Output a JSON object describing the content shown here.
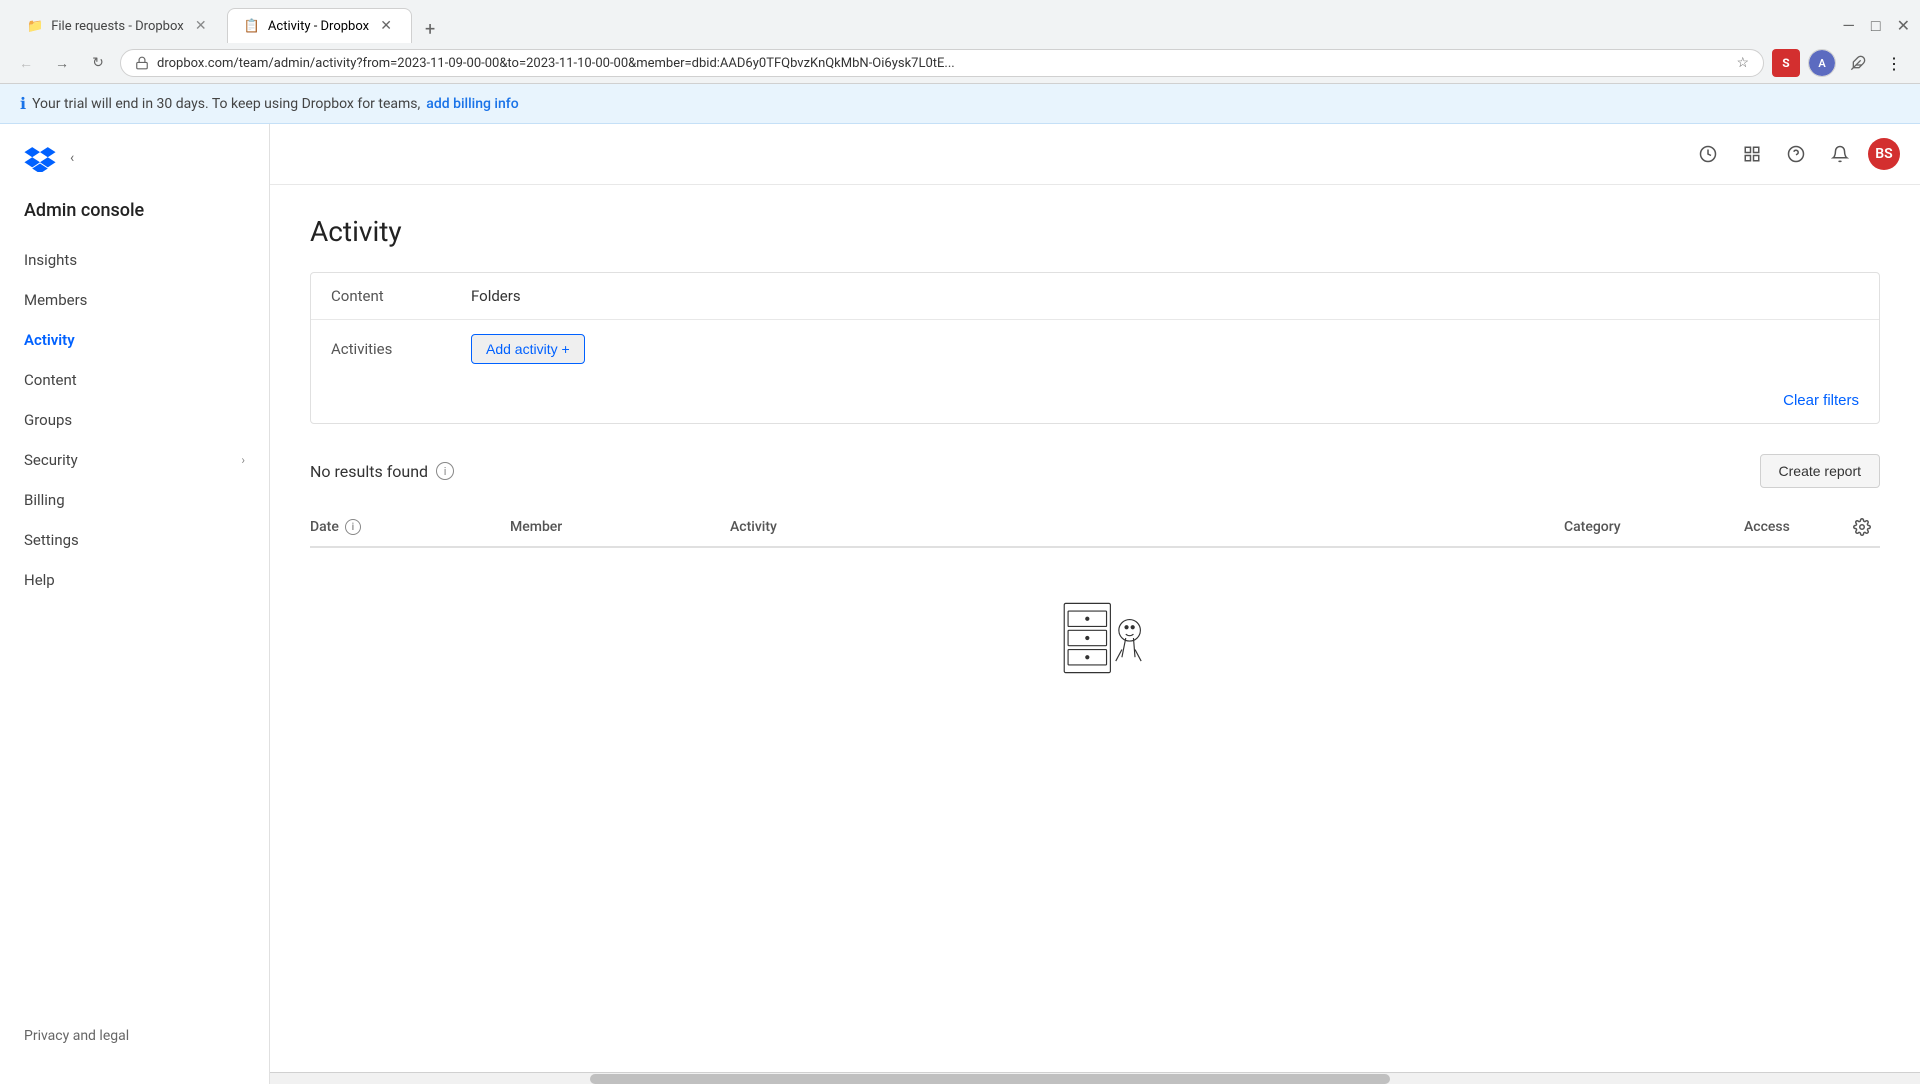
{
  "browser": {
    "tabs": [
      {
        "id": "tab1",
        "label": "File requests - Dropbox",
        "active": false,
        "favicon": "📁"
      },
      {
        "id": "tab2",
        "label": "Activity - Dropbox",
        "active": true,
        "favicon": "📋"
      }
    ],
    "url": "dropbox.com/team/admin/activity?from=2023-11-09-00-00&to=2023-11-10-00-00&member=dbid:AAD6y0TFQbvzKnQkMbN-Oi6ysk7L0tE...",
    "new_tab_label": "+",
    "window_controls": [
      "—",
      "□",
      "✕"
    ]
  },
  "trial_banner": {
    "icon": "ℹ",
    "text": "Your trial will end in 30 days. To keep using Dropbox for teams,",
    "link_text": "add billing info"
  },
  "sidebar": {
    "logo_alt": "Dropbox",
    "admin_console_label": "Admin console",
    "nav_items": [
      {
        "id": "insights",
        "label": "Insights",
        "active": false
      },
      {
        "id": "members",
        "label": "Members",
        "active": false
      },
      {
        "id": "activity",
        "label": "Activity",
        "active": true
      },
      {
        "id": "content",
        "label": "Content",
        "active": false
      },
      {
        "id": "groups",
        "label": "Groups",
        "active": false
      },
      {
        "id": "security",
        "label": "Security",
        "active": false,
        "has_chevron": true
      },
      {
        "id": "billing",
        "label": "Billing",
        "active": false
      },
      {
        "id": "settings",
        "label": "Settings",
        "active": false
      },
      {
        "id": "help",
        "label": "Help",
        "active": false
      }
    ],
    "footer_label": "Privacy and legal"
  },
  "topbar": {
    "icons": [
      "🕐",
      "⊞",
      "❓",
      "🔔"
    ],
    "user_initials": "BS"
  },
  "page": {
    "title": "Activity",
    "filters": {
      "content_label": "Content",
      "content_value": "Folders",
      "activities_label": "Activities",
      "add_activity_label": "Add activity +",
      "clear_filters_label": "Clear filters"
    },
    "results": {
      "no_results_text": "No results found",
      "create_report_label": "Create report",
      "table_columns": {
        "date": "Date",
        "member": "Member",
        "activity": "Activity",
        "category": "Category",
        "access": "Access"
      }
    }
  }
}
